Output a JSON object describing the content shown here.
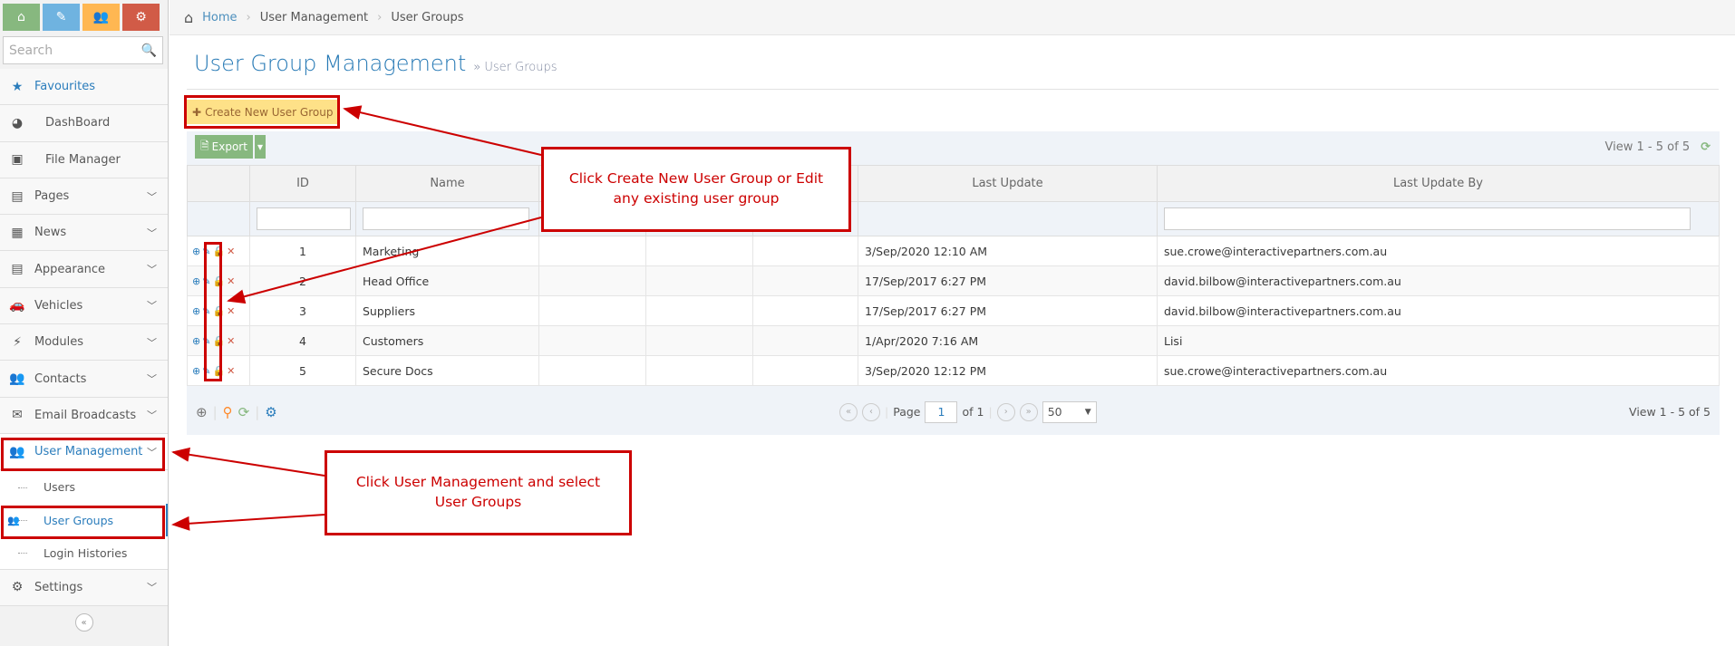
{
  "sidebar": {
    "top_buttons": [
      {
        "icon": "home-icon",
        "color": "#87b87f"
      },
      {
        "icon": "pencil-icon",
        "color": "#6fb3e0"
      },
      {
        "icon": "users-icon",
        "color": "#ffb752"
      },
      {
        "icon": "cogs-icon",
        "color": "#d15b47"
      }
    ],
    "search_placeholder": "Search",
    "items": [
      {
        "label": "Favourites",
        "icon": "star-icon"
      },
      {
        "label": "DashBoard",
        "icon": "dashboard-icon"
      },
      {
        "label": "File Manager",
        "icon": "picture-icon"
      },
      {
        "label": "Pages",
        "icon": "file-icon"
      },
      {
        "label": "News",
        "icon": "newspaper-icon"
      },
      {
        "label": "Appearance",
        "icon": "file-icon"
      },
      {
        "label": "Vehicles",
        "icon": "car-icon"
      },
      {
        "label": "Modules",
        "icon": "plug-icon"
      },
      {
        "label": "Contacts",
        "icon": "users-icon"
      },
      {
        "label": "Email Broadcasts",
        "icon": "envelope-icon"
      },
      {
        "label": "User Management",
        "icon": "users-icon"
      }
    ],
    "subitems": [
      {
        "label": "Users"
      },
      {
        "label": "User Groups"
      },
      {
        "label": "Login Histories"
      }
    ],
    "settings": "Settings"
  },
  "breadcrumb": [
    "Home",
    "User Management",
    "User Groups"
  ],
  "page": {
    "title": "User Group Management",
    "subtitle": "» User Groups"
  },
  "create_button": "Create New User Group",
  "export_button": "Export",
  "view_text": "View 1 - 5 of 5",
  "columns": [
    "",
    "ID",
    "Name",
    "",
    "",
    "",
    "Last Update",
    "Last Update By"
  ],
  "rows": [
    {
      "id": "1",
      "name": "Marketing",
      "last_update": "3/Sep/2020 12:10 AM",
      "by": "sue.crowe@interactivepartners.com.au"
    },
    {
      "id": "2",
      "name": "Head Office",
      "last_update": "17/Sep/2017 6:27 PM",
      "by": "david.bilbow@interactivepartners.com.au"
    },
    {
      "id": "3",
      "name": "Suppliers",
      "last_update": "17/Sep/2017 6:27 PM",
      "by": "david.bilbow@interactivepartners.com.au"
    },
    {
      "id": "4",
      "name": "Customers",
      "last_update": "1/Apr/2020 7:16 AM",
      "by": "Lisi"
    },
    {
      "id": "5",
      "name": "Secure Docs",
      "last_update": "3/Sep/2020 12:12 PM",
      "by": "sue.crowe@interactivepartners.com.au"
    }
  ],
  "pager": {
    "page_label": "Page",
    "page": "1",
    "of": "of 1",
    "page_size": "50",
    "view": "View 1 - 5 of 5"
  },
  "annotations": {
    "callout1": "Click Create New User Group or Edit any existing user group",
    "callout2": "Click User Management and select User Groups",
    "color": "#cc0000"
  }
}
